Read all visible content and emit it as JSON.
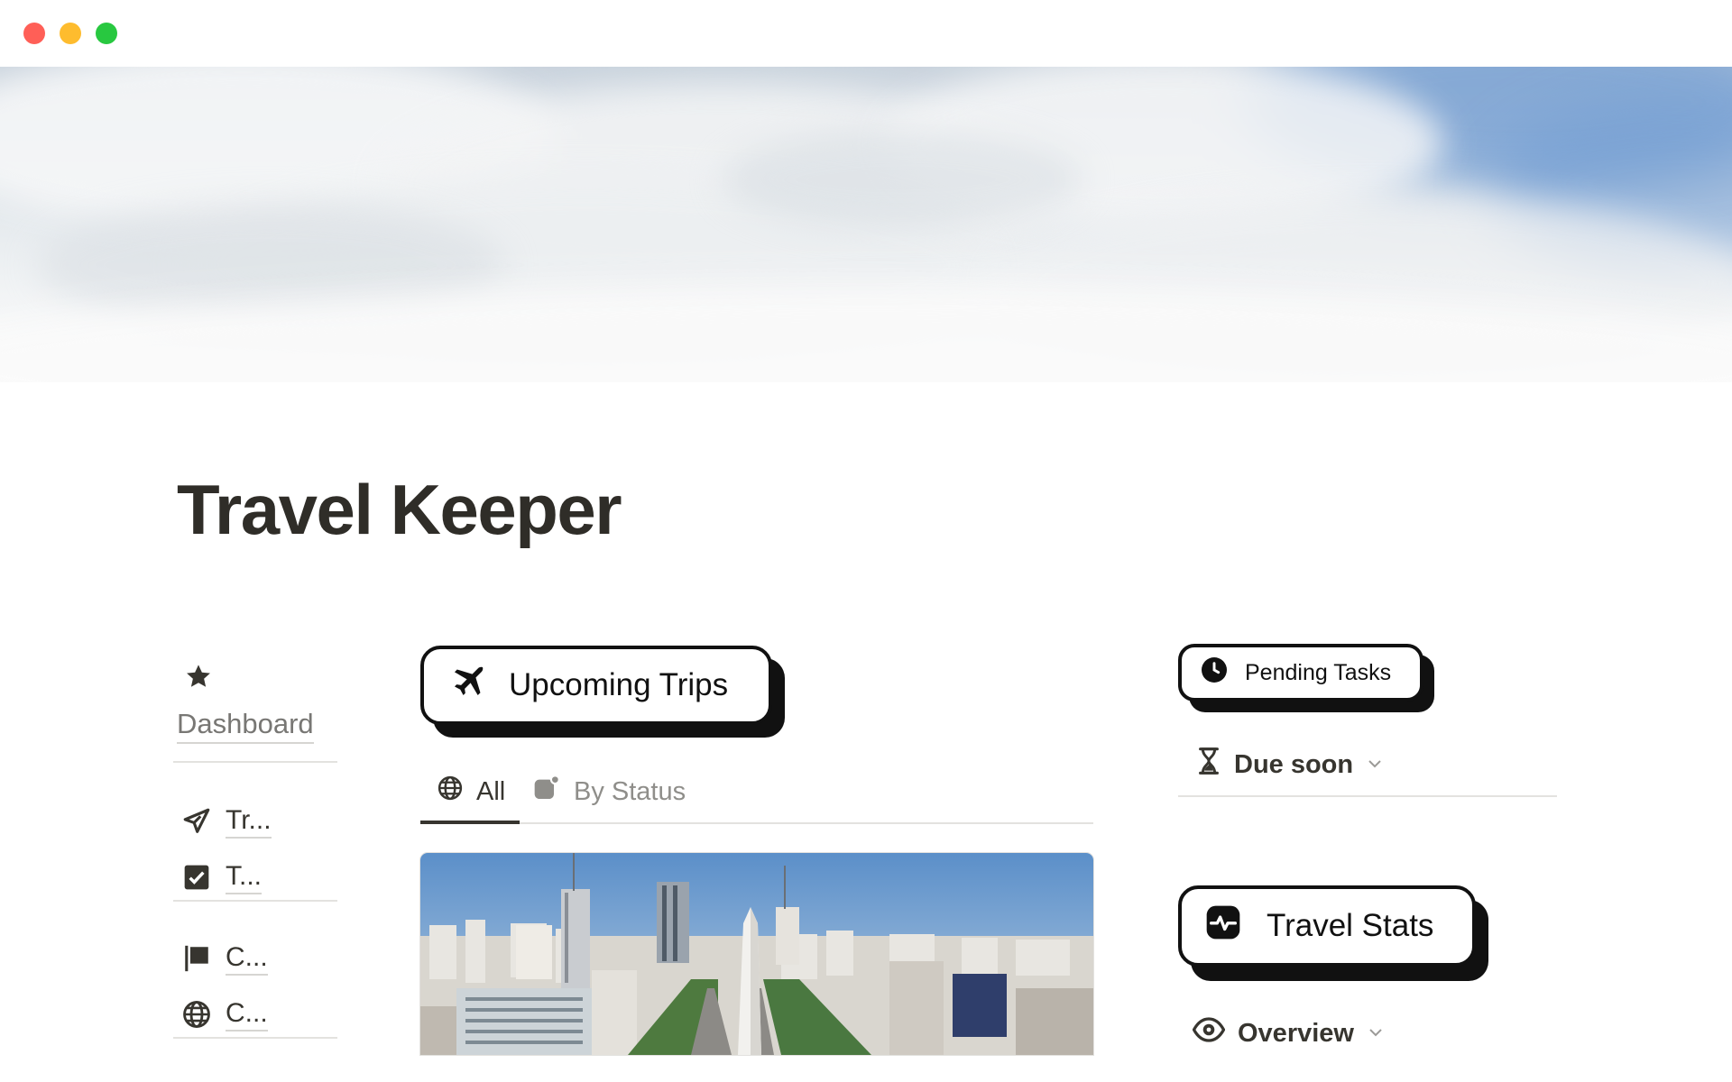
{
  "window": {
    "controls": [
      "close",
      "minimize",
      "zoom"
    ]
  },
  "page": {
    "title": "Travel Keeper"
  },
  "sidebar": {
    "dashboard_icon": "star-icon",
    "dashboard_label": "Dashboard",
    "items": [
      {
        "icon": "paper-plane-icon",
        "label": "Tr..."
      },
      {
        "icon": "checkbox-icon",
        "label": "T..."
      },
      {
        "icon": "flag-icon",
        "label": "C..."
      },
      {
        "icon": "globe-icon",
        "label": "C..."
      }
    ]
  },
  "upcoming_trips": {
    "icon": "airplane-icon",
    "title": "Upcoming Trips",
    "tabs": [
      {
        "icon": "globe-icon",
        "label": "All",
        "active": true
      },
      {
        "icon": "status-icon",
        "label": "By Status",
        "active": false
      }
    ],
    "card_image": "city-avenue-with-obelisk"
  },
  "pending_tasks": {
    "icon": "clock-icon",
    "title": "Pending Tasks",
    "view_icon": "hourglass-icon",
    "view_label": "Due soon"
  },
  "travel_stats": {
    "icon": "activity-icon",
    "title": "Travel Stats",
    "view_icon": "eye-icon",
    "view_label": "Overview"
  }
}
